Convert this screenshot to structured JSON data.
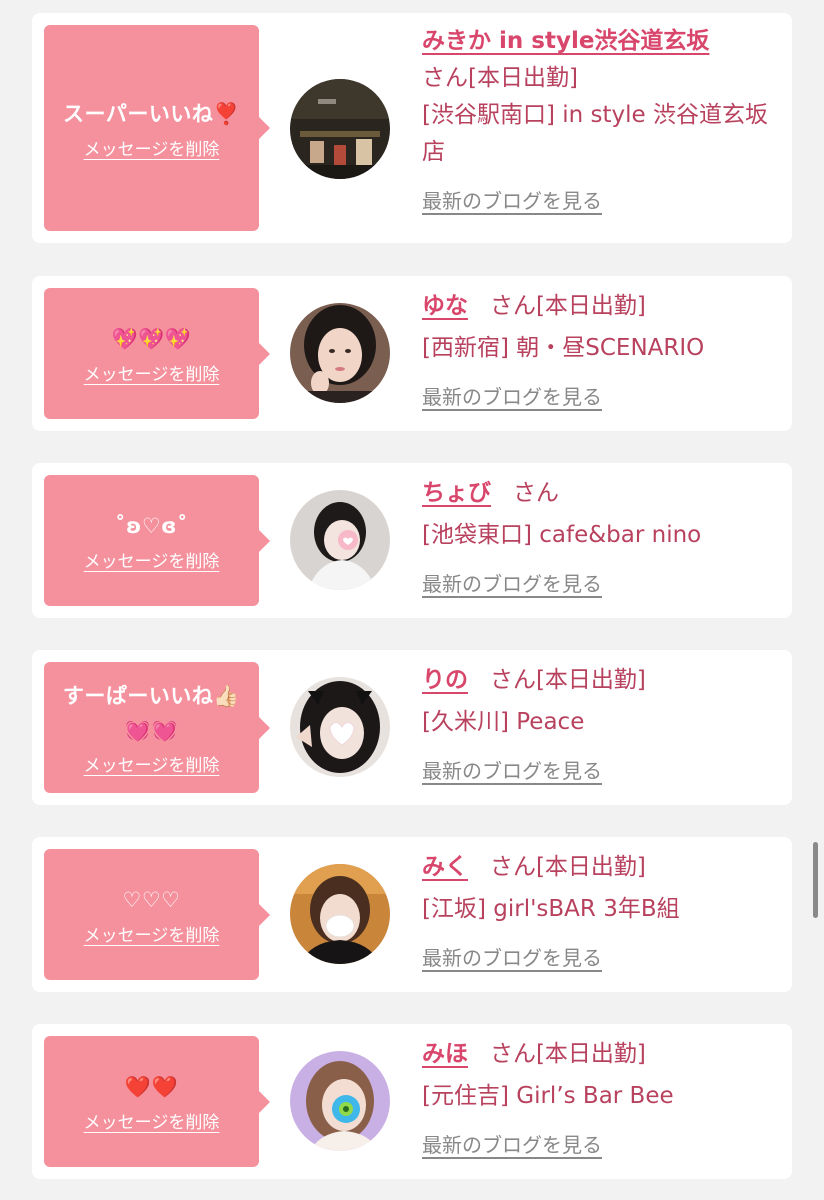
{
  "delete_label": "メッセージを削除",
  "blog_label": "最新のブログを見る",
  "colors": {
    "bubble": "#f4919d",
    "name": "#d9466c",
    "text": "#b8415e",
    "link_gray": "#888888",
    "background": "#f2f2f2"
  },
  "messages": [
    {
      "message": "スーパーいいね❣️",
      "name": "みきか in style渋谷道玄坂",
      "suffix": "さん[本日出勤]",
      "shop": "[渋谷駅南口] in style 渋谷道玄坂店"
    },
    {
      "message": "💖💖💖",
      "name": "ゆな",
      "suffix": "さん[本日出勤]",
      "shop": "[西新宿] 朝・昼SCENARIO"
    },
    {
      "message": "˚ʚ♡ɞ˚",
      "name": "ちょび",
      "suffix": "さん",
      "shop": "[池袋東口] cafe&bar nino"
    },
    {
      "message": "すーぱーいいね👍🏻\n💓💓",
      "name": "りの",
      "suffix": "さん[本日出勤]",
      "shop": "[久米川] Peace"
    },
    {
      "message": "♡♡♡",
      "name": "みく",
      "suffix": "さん[本日出勤]",
      "shop": "[江坂] girl'sBAR 3年B組"
    },
    {
      "message": "❤️❤️",
      "name": "みほ",
      "suffix": "さん[本日出勤]",
      "shop": "[元住吉] Girl’s Bar Bee"
    }
  ]
}
